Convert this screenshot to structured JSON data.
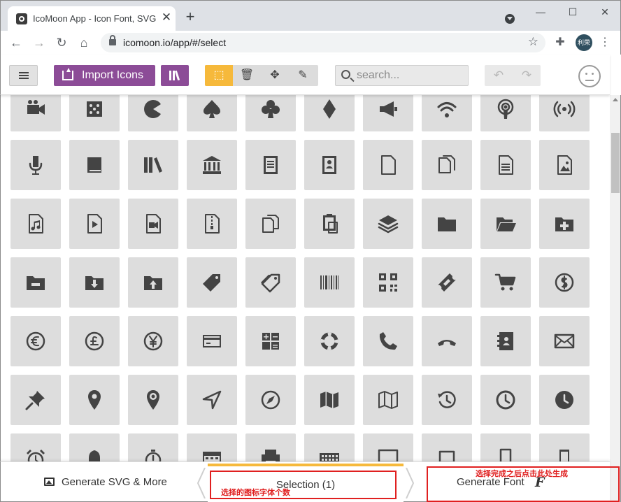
{
  "browser": {
    "tab_title": "IcoMoon App - Icon Font, SVG",
    "tab_close": "✕",
    "new_tab": "+",
    "url": "icomoon.io/app/#/select",
    "profile_label": "利荣"
  },
  "header": {
    "import_label": "Import Icons",
    "search_placeholder": "search..."
  },
  "icon_grid": {
    "rows": [
      [
        "video-camera",
        "dice",
        "pacman",
        "spades",
        "clubs",
        "diamonds",
        "bullhorn",
        "connection",
        "podcast",
        "feed"
      ],
      [
        "mic",
        "book",
        "books",
        "library",
        "file-text",
        "profile",
        "file-empty",
        "files-empty",
        "file-text2",
        "file-picture"
      ],
      [
        "file-music",
        "file-play",
        "file-video",
        "file-zip",
        "copy",
        "paste",
        "stack",
        "folder",
        "folder-open",
        "folder-plus"
      ],
      [
        "folder-minus",
        "folder-download",
        "folder-upload",
        "price-tag",
        "price-tags",
        "barcode",
        "qrcode",
        "ticket",
        "cart",
        "coin-dollar"
      ],
      [
        "coin-euro",
        "coin-pound",
        "coin-yen",
        "credit-card",
        "calculator",
        "lifebuoy",
        "phone",
        "phone-hang-up",
        "address-book",
        "envelop"
      ],
      [
        "pushpin",
        "location",
        "location2",
        "compass",
        "compass2",
        "map",
        "map2",
        "history",
        "clock",
        "clock2"
      ],
      [
        "alarm",
        "bell",
        "stopwatch",
        "calendar",
        "printer",
        "keyboard",
        "display",
        "laptop",
        "mobile",
        "mobile2"
      ]
    ]
  },
  "footer": {
    "generate_svg_label": "Generate SVG & More",
    "selection_label": "Selection (1)",
    "generate_font_label": "Generate Font",
    "generate_font_glyph": "F"
  },
  "annotations": {
    "selection_note": "选择的图标字体个数",
    "generate_note": "选择完成之后点击此处生成",
    "color": "#e02020"
  },
  "theme": {
    "accent_purple": "#8c4c97",
    "accent_yellow": "#f6b93b",
    "tile_bg": "#dddddd",
    "icon_color": "#444444"
  }
}
